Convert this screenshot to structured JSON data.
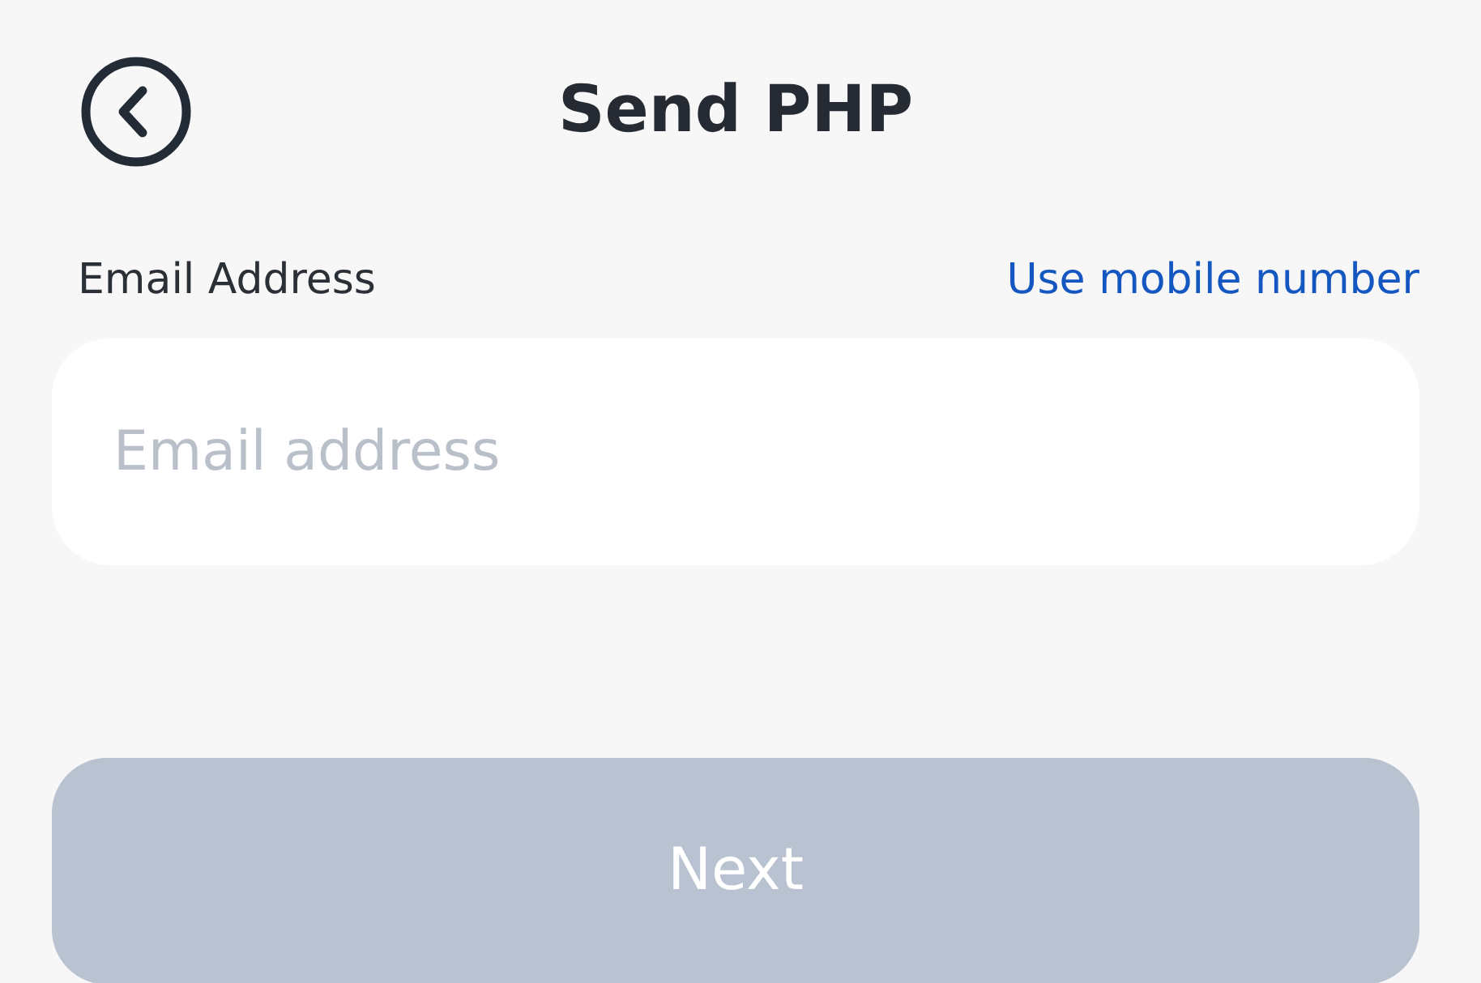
{
  "header": {
    "title": "Send PHP"
  },
  "form": {
    "label": "Email Address",
    "switch_link": "Use mobile number",
    "field": {
      "placeholder": "Email address"
    }
  },
  "next_button": {
    "label": "Next",
    "disabled": true
  }
}
